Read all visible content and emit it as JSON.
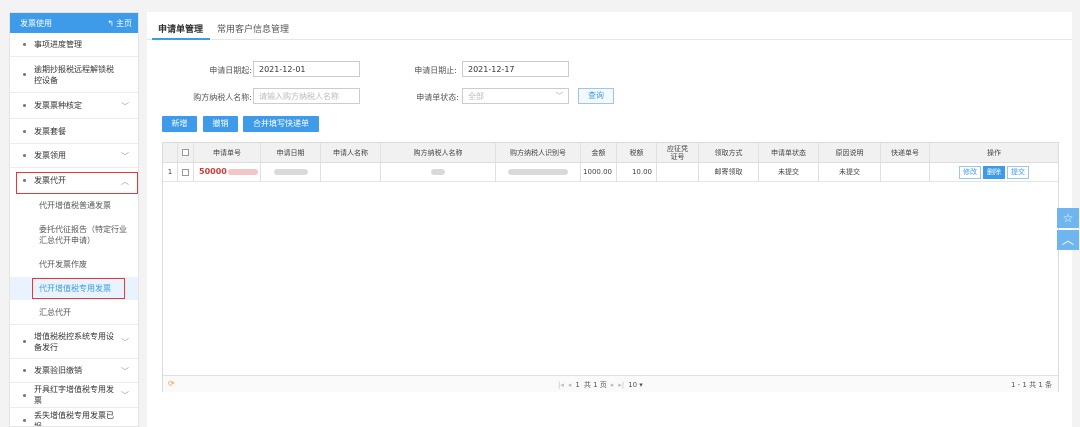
{
  "sidebar": {
    "title": "发票使用",
    "home_label": "主页",
    "items": [
      {
        "label": "事项进度管理"
      },
      {
        "label": "逾期抄报税远程解锁税控设备"
      },
      {
        "label": "发票票种核定"
      },
      {
        "label": "发票套餐"
      },
      {
        "label": "发票领用"
      },
      {
        "label": "发票代开"
      },
      {
        "label": "增值税税控系统专用设备发行"
      },
      {
        "label": "发票验旧缴销"
      },
      {
        "label": "开具红字增值税专用发票"
      },
      {
        "label": "丢失增值税专用发票已报"
      }
    ],
    "subitems": [
      {
        "label": "代开增值税普通发票"
      },
      {
        "label": "委托代征报告（特定行业汇总代开申请）"
      },
      {
        "label": "代开发票作废"
      },
      {
        "label": "代开增值税专用发票"
      },
      {
        "label": "汇总代开"
      }
    ]
  },
  "tabs": [
    {
      "label": "申请单管理"
    },
    {
      "label": "常用客户信息管理"
    }
  ],
  "filters": {
    "start_label": "申请日期起:",
    "start_value": "2021-12-01",
    "end_label": "申请日期止:",
    "end_value": "2021-12-17",
    "buyer_label": "购方纳税人名称:",
    "buyer_placeholder": "请输入购方纳税人名称",
    "status_label": "申请单状态:",
    "status_value": "全部",
    "query_label": "查询"
  },
  "actions": {
    "add": "新增",
    "cancel": "撤销",
    "merge": "合并填写快递单"
  },
  "table": {
    "headers": [
      "申请单号",
      "申请日期",
      "申请人名称",
      "购方纳税人名称",
      "购方纳税人识别号",
      "金额",
      "税额",
      "应征凭证号",
      "领取方式",
      "申请单状态",
      "原因说明",
      "快递单号",
      "操作"
    ],
    "rows": [
      {
        "index": "1",
        "app_no": "50000",
        "amount": "1000.00",
        "tax": "10.00",
        "pickup": "邮寄领取",
        "status": "未提交",
        "reason": "未提交",
        "ops": [
          "修改",
          "删除",
          "提交"
        ]
      }
    ]
  },
  "pager": {
    "first": "|◂",
    "prev": "◂",
    "page": "1",
    "pages_text": "共 1 页",
    "next": "▸",
    "last": "▸|",
    "page_size": "10 ▾",
    "summary": "1 - 1   共 1 条"
  },
  "colors": {
    "accent": "#3d9be9",
    "highlight_box": "#e23a3a",
    "app_no": "#d23a3a"
  },
  "icons": {
    "home": "home-icon",
    "chevron": "chevron-down-icon",
    "star": "star-icon",
    "up": "chevron-up-icon",
    "refresh": "refresh-icon"
  }
}
